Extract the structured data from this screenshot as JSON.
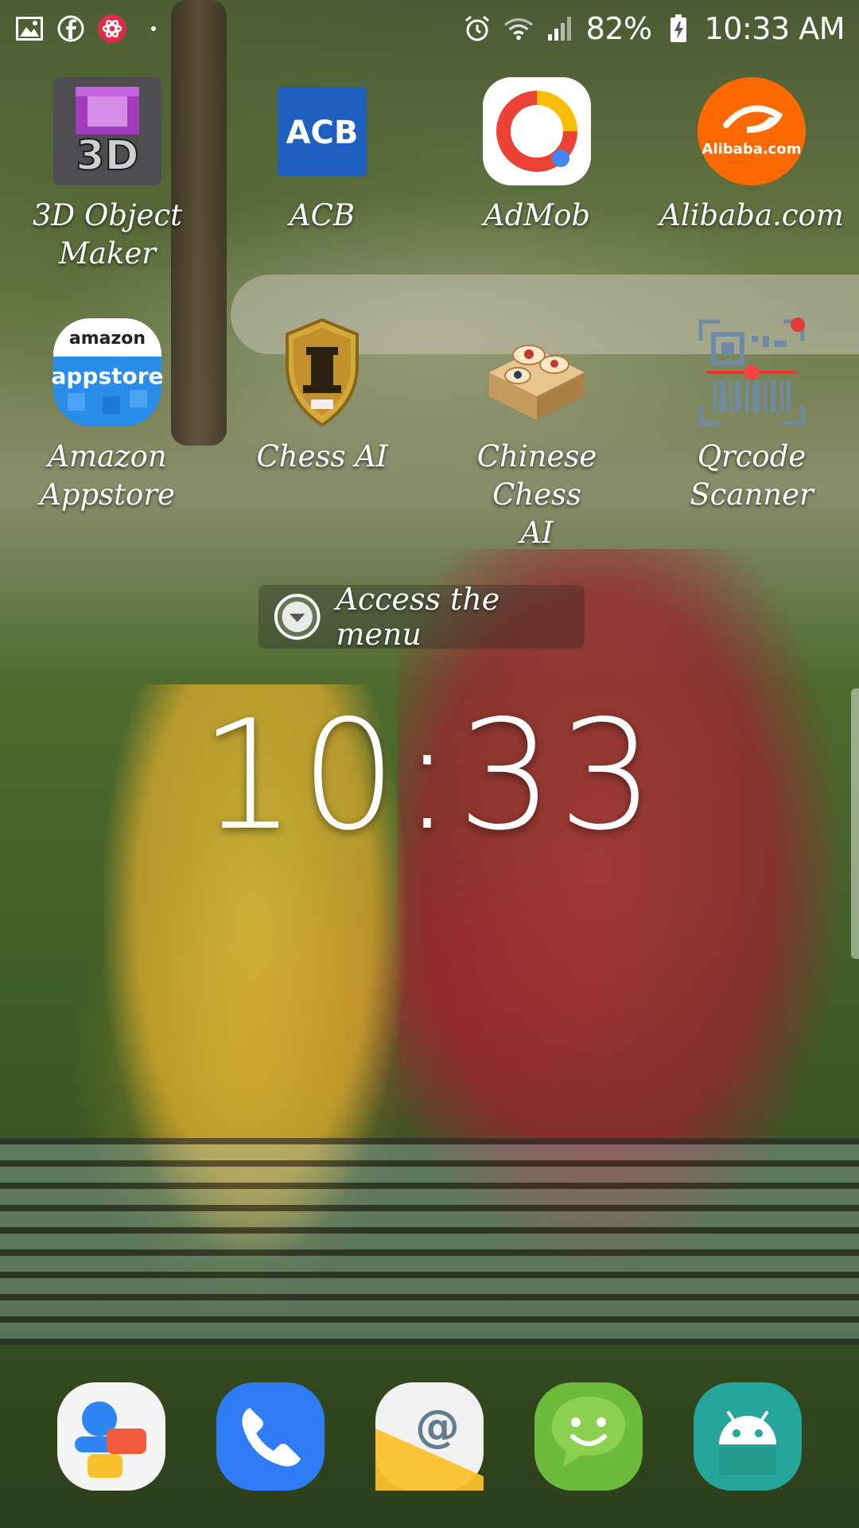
{
  "status_bar": {
    "battery_percent": "82%",
    "time": "10:33 AM",
    "left_icons": [
      "gallery-icon",
      "facebook-icon",
      "app-notification-icon",
      "more-dot-icon"
    ],
    "right_icons": [
      "alarm-icon",
      "wifi-icon",
      "signal-icon",
      "battery-charging-icon"
    ]
  },
  "apps": [
    {
      "label": "3D Object\nMaker",
      "icon": "3d-object-maker-icon",
      "color": "#5a5a5a"
    },
    {
      "label": "ACB",
      "icon": "acb-icon",
      "icon_text": "ACB",
      "color": "#1f5fbf"
    },
    {
      "label": "AdMob",
      "icon": "admob-icon",
      "color": "#ea4335"
    },
    {
      "label": "Alibaba.com",
      "icon": "alibaba-icon",
      "icon_text": "Alibaba.com",
      "color": "#ff6a00"
    },
    {
      "label": "Amazon\nAppstore",
      "icon": "amazon-appstore-icon",
      "icon_text_top": "amazon",
      "icon_text_bottom": "appstore",
      "color": "#2a8de9"
    },
    {
      "label": "Chess AI",
      "icon": "chess-ai-icon",
      "color": "#c9a23a"
    },
    {
      "label": "Chinese Chess\nAI",
      "icon": "chinese-chess-ai-icon",
      "color": "#d9b37a"
    },
    {
      "label": "Qrcode\nScanner",
      "icon": "qrcode-scanner-icon",
      "color": "#8ea2b6"
    }
  ],
  "access_menu": {
    "text": "Access the menu"
  },
  "clock": {
    "time": "10:33"
  },
  "dock": [
    {
      "icon": "contacts-icon"
    },
    {
      "icon": "phone-icon"
    },
    {
      "icon": "email-icon",
      "icon_text": "@"
    },
    {
      "icon": "messages-icon"
    },
    {
      "icon": "android-icon"
    }
  ]
}
